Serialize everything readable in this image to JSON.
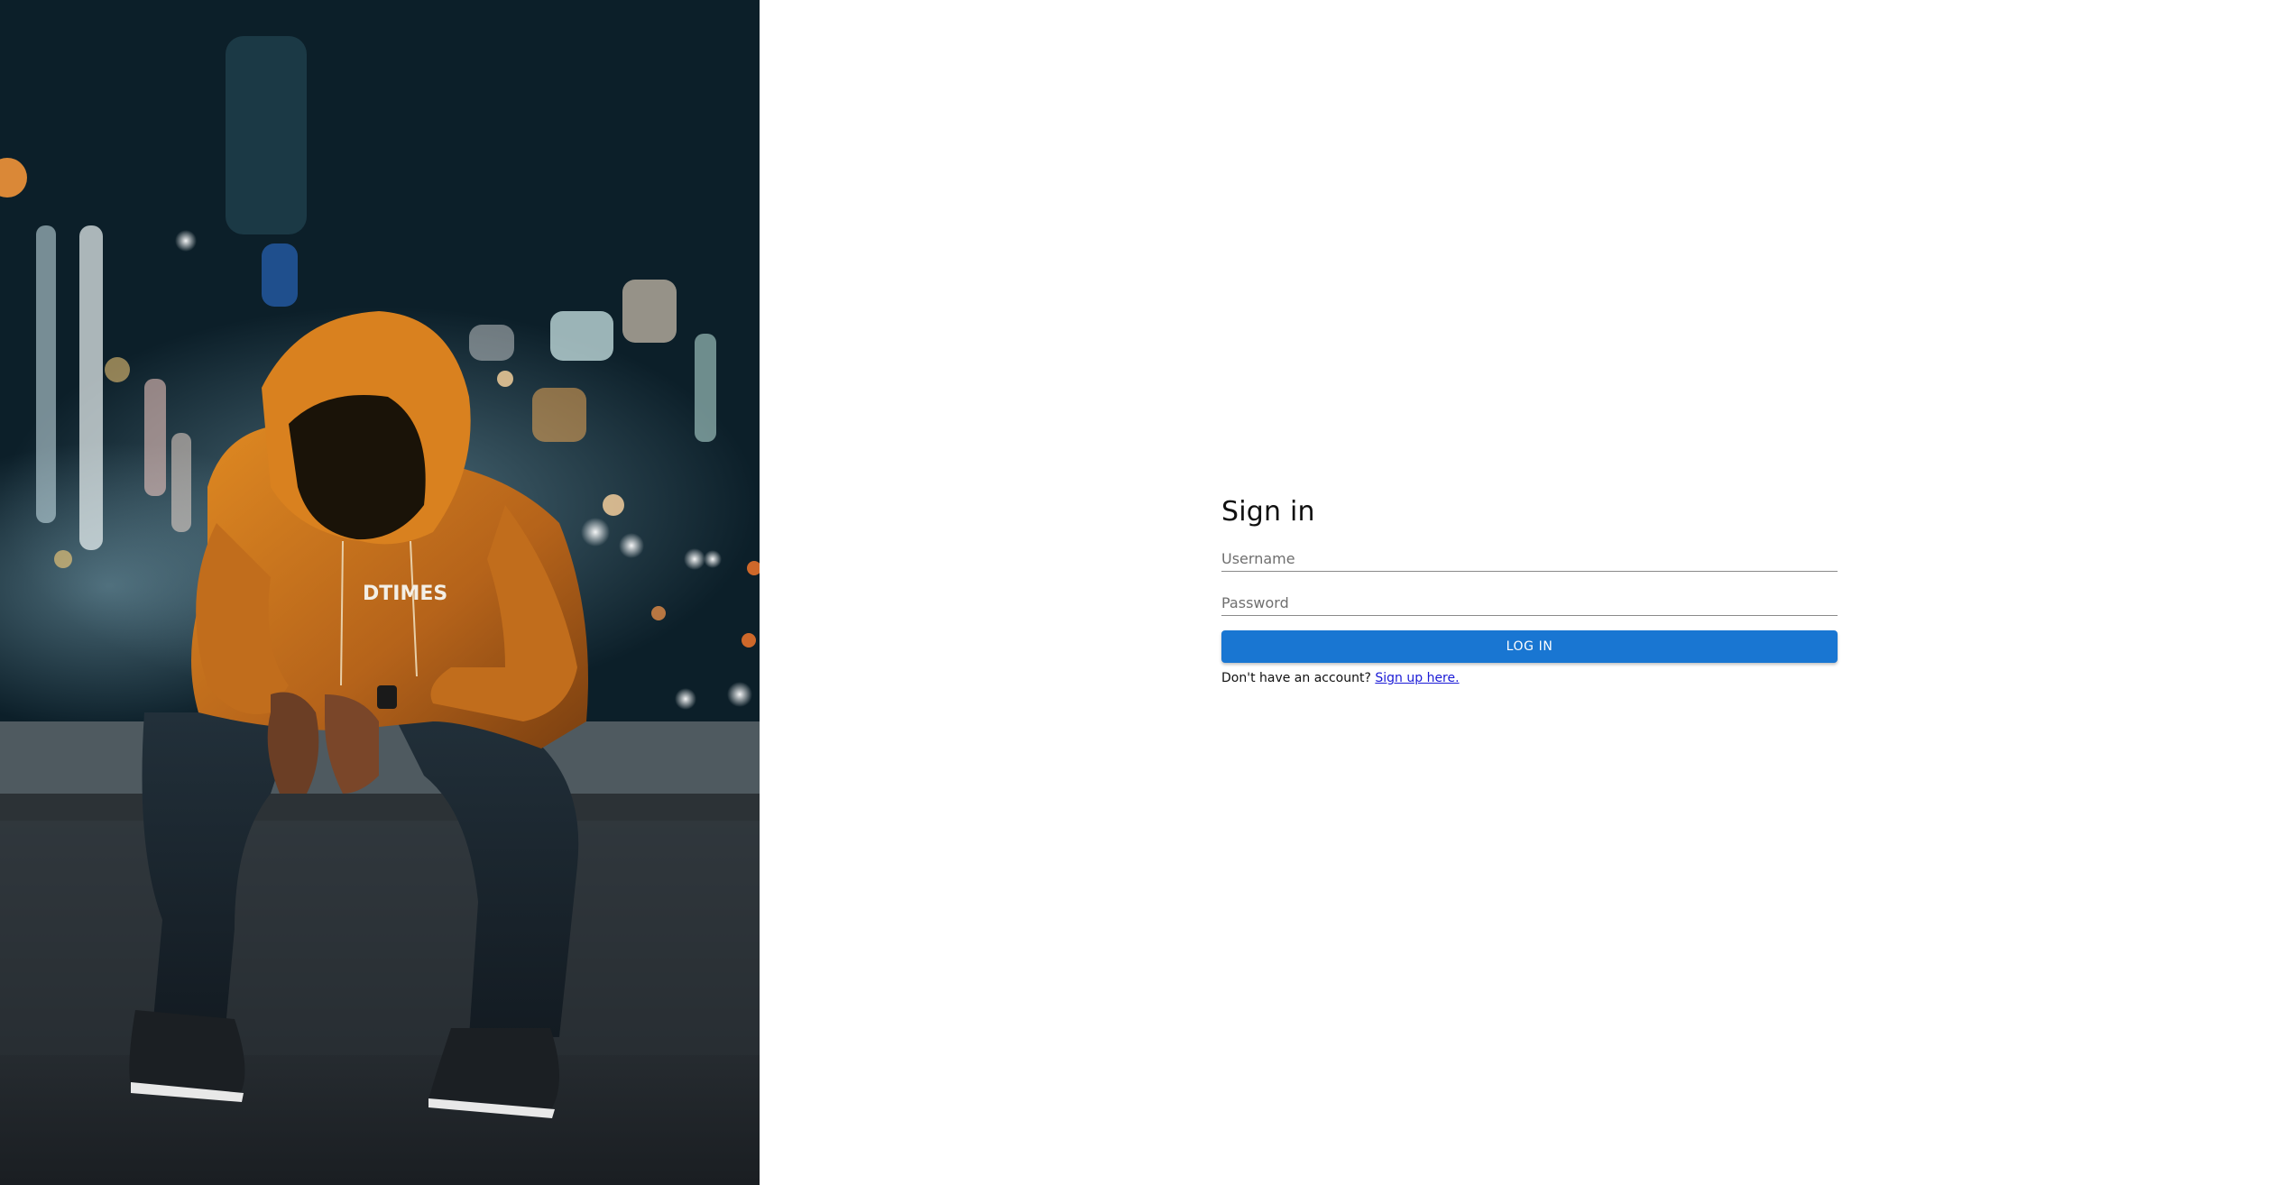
{
  "hero": {
    "image_description_icon": "photo-icon",
    "hoodie_print": "DTIMES"
  },
  "signin": {
    "title": "Sign in",
    "username": {
      "placeholder": "Username",
      "value": ""
    },
    "password": {
      "placeholder": "Password",
      "value": ""
    },
    "login_label": "LOG IN",
    "signup_prompt": "Don't have an account?",
    "signup_link": "Sign up here."
  },
  "colors": {
    "primary": "#1976d2",
    "link": "#1a1ad6",
    "hoodie": "#c8741a"
  }
}
